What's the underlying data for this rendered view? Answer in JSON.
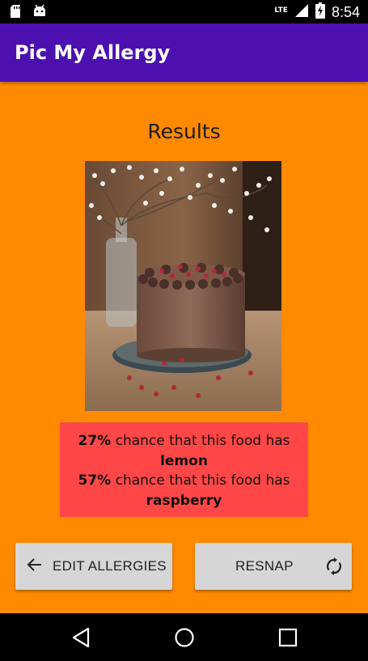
{
  "status_bar": {
    "network_label": "LTE",
    "time": "8:54",
    "icons": [
      "sd-card-icon",
      "android-icon",
      "signal-icon",
      "battery-charging-icon"
    ]
  },
  "app_bar": {
    "title": "Pic My Allergy"
  },
  "main": {
    "heading": "Results",
    "image_icon": "photo-chocolate-cake",
    "results": [
      {
        "percent": "27%",
        "text": " chance that this food has",
        "ingredient": "lemon"
      },
      {
        "percent": "57%",
        "text": " chance that this food has",
        "ingredient": "raspberry"
      }
    ]
  },
  "buttons": {
    "edit_allergies": "EDIT ALLERGIES",
    "resnap": "RESNAP"
  },
  "nav_bar": {
    "icons": [
      "back-icon",
      "home-icon",
      "recents-icon"
    ]
  },
  "colors": {
    "background": "#ff8a00",
    "app_bar": "#4c0fb0",
    "result_box": "#ff4747",
    "button": "#d6d6d6"
  }
}
